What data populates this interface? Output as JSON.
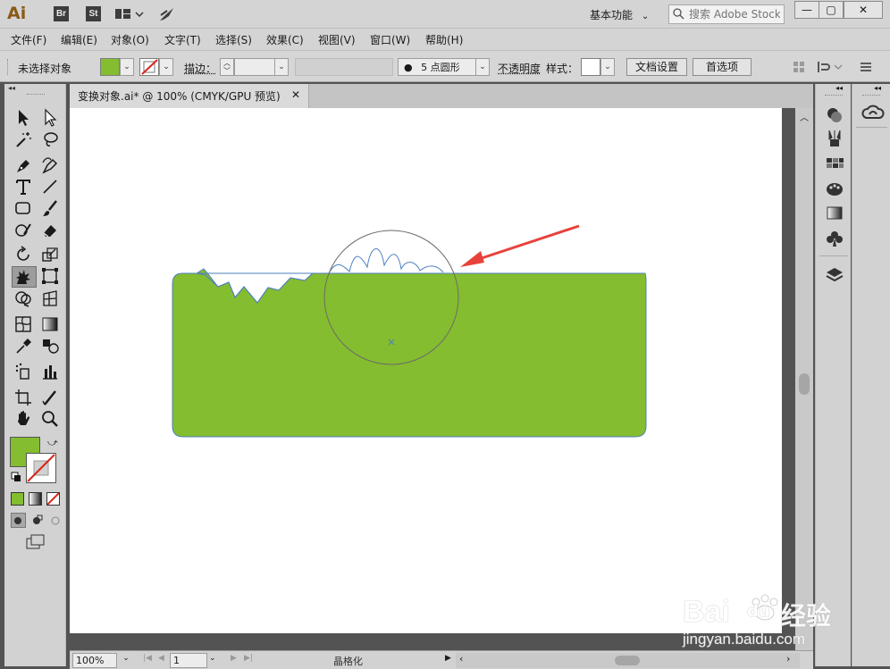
{
  "app": {
    "logo": "Ai",
    "bridge_badge": "Br",
    "stock_badge": "St",
    "workspace": "基本功能",
    "search_placeholder": "搜索 Adobe Stock"
  },
  "menu": [
    "文件(F)",
    "编辑(E)",
    "对象(O)",
    "文字(T)",
    "选择(S)",
    "效果(C)",
    "视图(V)",
    "窗口(W)",
    "帮助(H)"
  ],
  "control_bar": {
    "selection_status": "未选择对象",
    "stroke_label": "描边：",
    "brush": "5 点圆形",
    "opacity_label": "不透明度",
    "style_label": "样式：",
    "doc_setup_button": "文档设置",
    "preferences_button": "首选项",
    "fill_color": "#84bd2f",
    "stroke_color": "none"
  },
  "document": {
    "tab_title": "变换对象.ai* @ 100% (CMYK/GPU 预览)"
  },
  "statusbar": {
    "zoom": "100%",
    "artboard_number": "1",
    "status_text": "晶格化"
  },
  "tools": {
    "fill_color": "#84bd2f"
  },
  "watermark": {
    "line1": "Bai",
    "line2_cn": "经验",
    "line3": "jingyan.baidu.com"
  },
  "colors": {
    "accent_green": "#84bd2f",
    "arrow_red": "#e8413c",
    "path_blue": "#4f7fc2"
  }
}
